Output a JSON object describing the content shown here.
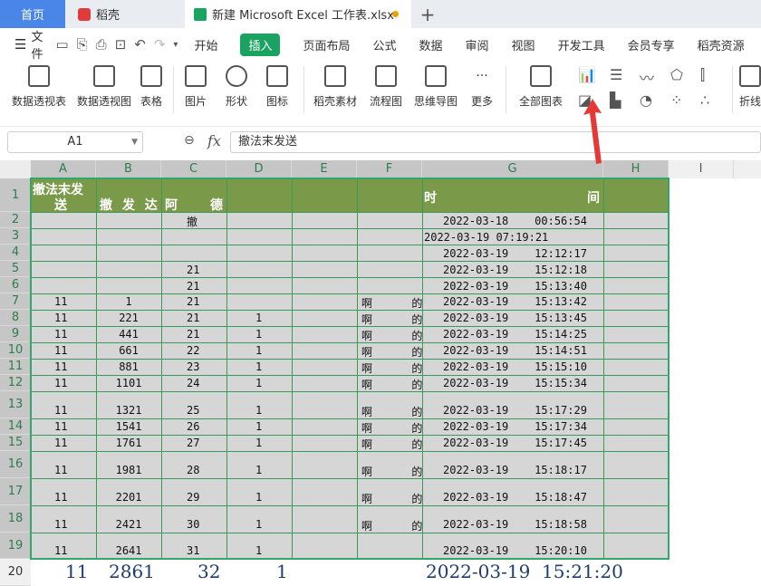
{
  "tabs": {
    "home": "首页",
    "doc": "稻壳",
    "file": "新建 Microsoft Excel 工作表.xlsx",
    "add": "+"
  },
  "menu": {
    "file": "文件",
    "items": [
      "开始",
      "插入",
      "页面布局",
      "公式",
      "数据",
      "审阅",
      "视图",
      "开发工具",
      "会员专享",
      "稻壳资源"
    ],
    "active": "插入"
  },
  "ribbon": {
    "buttons": [
      "数据透视表",
      "数据透视图",
      "表格",
      "图片",
      "形状",
      "图标",
      "稻壳素材",
      "流程图",
      "思维导图",
      "更多",
      "全部图表",
      "折线"
    ]
  },
  "formula": {
    "cell": "A1",
    "content": "撤法末发送"
  },
  "sheet": {
    "columns": [
      "A",
      "B",
      "C",
      "D",
      "E",
      "F",
      "G",
      "H",
      "I"
    ],
    "rows": [
      "1",
      "2",
      "3",
      "4",
      "5",
      "6",
      "7",
      "8",
      "9",
      "10",
      "11",
      "12",
      "13",
      "14",
      "15",
      "16",
      "17",
      "18",
      "19",
      "20"
    ],
    "header": {
      "a1": "撤法末发",
      "a1b": "送",
      "b": "撤 发 达",
      "c": "阿",
      "cd": "德",
      "g1": "时",
      "g2": "间"
    },
    "r2c": "撤",
    "r2g": "2022-03-18    00:56:54",
    "r3g": "2022-03-19 07:19:21",
    "r4g": "2022-03-19    12:12:17",
    "r5c": "21",
    "r5g": "2022-03-19    15:12:18",
    "r6c": "21",
    "r6g": "2022-03-19    15:13:40",
    "data": [
      {
        "a": "11",
        "b": "1",
        "c": "21",
        "d": "",
        "f": "啊      的",
        "g": "2022-03-19    15:13:42"
      },
      {
        "a": "11",
        "b": "221",
        "c": "21",
        "d": "1",
        "f": "啊      的",
        "g": "2022-03-19    15:13:45"
      },
      {
        "a": "11",
        "b": "441",
        "c": "21",
        "d": "1",
        "f": "啊      的",
        "g": "2022-03-19    15:14:25"
      },
      {
        "a": "11",
        "b": "661",
        "c": "22",
        "d": "1",
        "f": "啊      的",
        "g": "2022-03-19    15:14:51"
      },
      {
        "a": "11",
        "b": "881",
        "c": "23",
        "d": "1",
        "f": "啊      的",
        "g": "2022-03-19    15:15:10"
      },
      {
        "a": "11",
        "b": "1101",
        "c": "24",
        "d": "1",
        "f": "啊      的",
        "g": "2022-03-19    15:15:34"
      },
      {
        "a": "11",
        "b": "1321",
        "c": "25",
        "d": "1",
        "f": "啊      的",
        "g": "2022-03-19    15:17:29"
      },
      {
        "a": "11",
        "b": "1541",
        "c": "26",
        "d": "1",
        "f": "啊      的",
        "g": "2022-03-19    15:17:34"
      },
      {
        "a": "11",
        "b": "1761",
        "c": "27",
        "d": "1",
        "f": "啊      的",
        "g": "2022-03-19    15:17:45"
      },
      {
        "a": "11",
        "b": "1981",
        "c": "28",
        "d": "1",
        "f": "啊      的",
        "g": "2022-03-19    15:18:17"
      },
      {
        "a": "11",
        "b": "2201",
        "c": "29",
        "d": "1",
        "f": "啊      的",
        "g": "2022-03-19    15:18:47"
      },
      {
        "a": "11",
        "b": "2421",
        "c": "30",
        "d": "1",
        "f": "啊      的",
        "g": "2022-03-19    15:18:58"
      },
      {
        "a": "11",
        "b": "2641",
        "c": "31",
        "d": "1",
        "f": "",
        "g": "2022-03-19    15:20:10"
      }
    ],
    "row20": {
      "a": "11",
      "b": "2861",
      "c": "32",
      "d": "1",
      "g": "2022-03-19  15:21:20"
    }
  },
  "colors": {
    "accent": "#1aa260",
    "header_band": "#7a9a4a",
    "selection": "#2fa86a",
    "arrow": "#e53935",
    "home_tab": "#4a86e8"
  },
  "icons": [
    "save-icon",
    "print-icon",
    "undo-icon",
    "redo-icon",
    "zoom-icon",
    "fx-icon",
    "arrow-annotation"
  ]
}
